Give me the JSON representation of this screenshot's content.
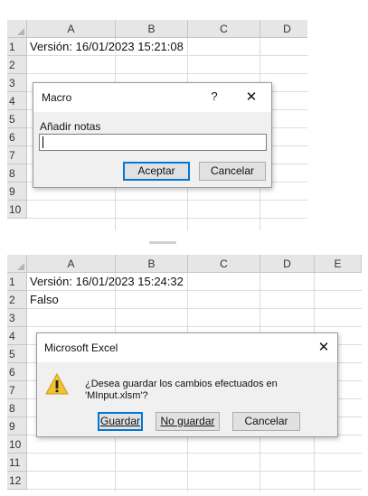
{
  "top_sheet": {
    "columns": [
      "A",
      "B",
      "C",
      "D"
    ],
    "rows": [
      "1",
      "2",
      "3",
      "4",
      "5",
      "6",
      "7",
      "8",
      "9",
      "10"
    ],
    "cells": {
      "A1": "Versión: 16/01/2023 15:21:08"
    }
  },
  "macro_dialog": {
    "title": "Macro",
    "help_symbol": "?",
    "close_symbol": "✕",
    "prompt": "Añadir notas",
    "input_value": "",
    "ok_label": "Aceptar",
    "cancel_label": "Cancelar"
  },
  "bottom_sheet": {
    "columns": [
      "A",
      "B",
      "C",
      "D",
      "E"
    ],
    "rows": [
      "1",
      "2",
      "3",
      "4",
      "5",
      "6",
      "7",
      "8",
      "9",
      "10",
      "11",
      "12"
    ],
    "cells": {
      "A1": "Versión: 16/01/2023 15:24:32",
      "A2": "Falso"
    }
  },
  "save_dialog": {
    "title": "Microsoft Excel",
    "close_symbol": "✕",
    "icon": "warning-icon",
    "message_line1": "¿Desea guardar los cambios efectuados en",
    "message_line2": "'MInput.xlsm'?",
    "save_label": "Guardar",
    "nosave_label": "No guardar",
    "cancel_label": "Cancelar"
  },
  "colors": {
    "header_bg": "#e6e6e6",
    "grid_line": "#dcdcdc",
    "dialog_bg": "#f0f0f0",
    "focus_border": "#0078d7",
    "warning_yellow": "#f2c230"
  }
}
